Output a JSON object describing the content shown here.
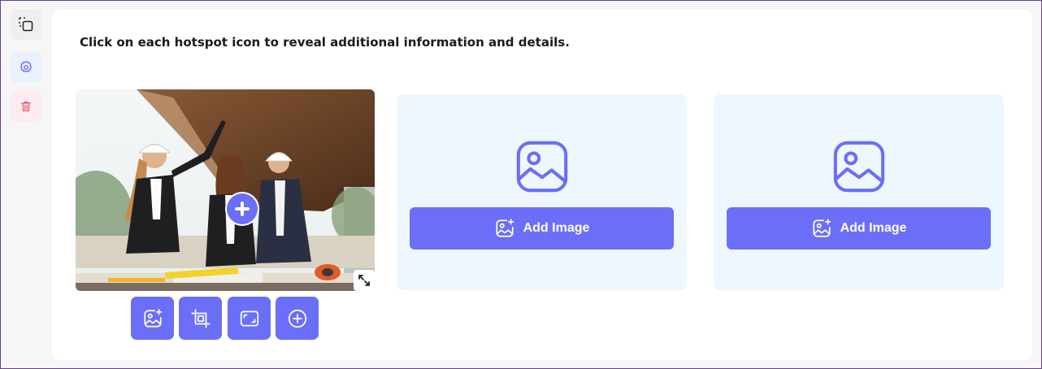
{
  "sidebar": {
    "actions": [
      {
        "icon": "copy-icon"
      },
      {
        "icon": "gear-icon"
      },
      {
        "icon": "trash-icon"
      }
    ]
  },
  "content": {
    "instruction": "Click on each hotspot icon to reveal additional information and details."
  },
  "image_slots": [
    {
      "state": "filled",
      "hotspot_icon": "plus-icon",
      "expand_icon": "expand-icon"
    },
    {
      "state": "empty",
      "placeholder_icon": "image-placeholder-icon",
      "button_icon": "add-image-icon",
      "button_label": "Add Image"
    },
    {
      "state": "empty",
      "placeholder_icon": "image-placeholder-icon",
      "button_icon": "add-image-icon",
      "button_label": "Add Image"
    }
  ],
  "image_toolbar": [
    {
      "icon": "image-sparkle-icon"
    },
    {
      "icon": "crop-icon"
    },
    {
      "icon": "aspect-ratio-icon"
    },
    {
      "icon": "plus-circle-icon"
    }
  ],
  "colors": {
    "accent": "#6b6ef7",
    "card_background": "#eef7fd",
    "danger": "#f0596f",
    "panel_background": "#ffffff",
    "page_background": "#f6f6f7"
  }
}
